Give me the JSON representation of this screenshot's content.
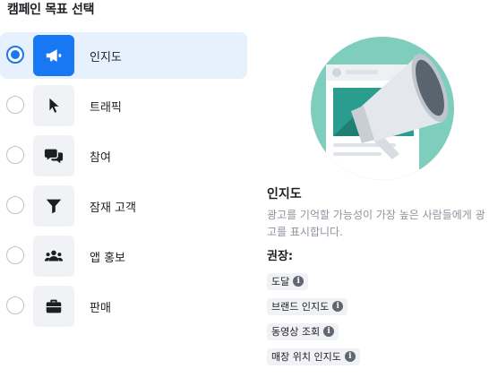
{
  "header": {
    "title": "캠페인 목표 선택"
  },
  "objectives": [
    {
      "label": "인지도",
      "icon": "megaphone-icon",
      "selected": true
    },
    {
      "label": "트래픽",
      "icon": "cursor-icon",
      "selected": false
    },
    {
      "label": "참여",
      "icon": "chat-bubbles-icon",
      "selected": false
    },
    {
      "label": "잠재 고객",
      "icon": "funnel-icon",
      "selected": false
    },
    {
      "label": "앱 홍보",
      "icon": "people-icon",
      "selected": false
    },
    {
      "label": "판매",
      "icon": "briefcase-icon",
      "selected": false
    }
  ],
  "detail": {
    "title": "인지도",
    "description": "광고를 기억할 가능성이 가장 높은 사람들에게 광고를 표시합니다.",
    "recommended_label": "권장:",
    "tags": [
      "도달",
      "브랜드 인지도",
      "동영상 조회",
      "매장 위치 인지도"
    ],
    "info_glyph": "i"
  },
  "colors": {
    "accent": "#1877f2",
    "selected_bg": "#e7f0fd",
    "illustration_bg": "#7fcdbd"
  }
}
